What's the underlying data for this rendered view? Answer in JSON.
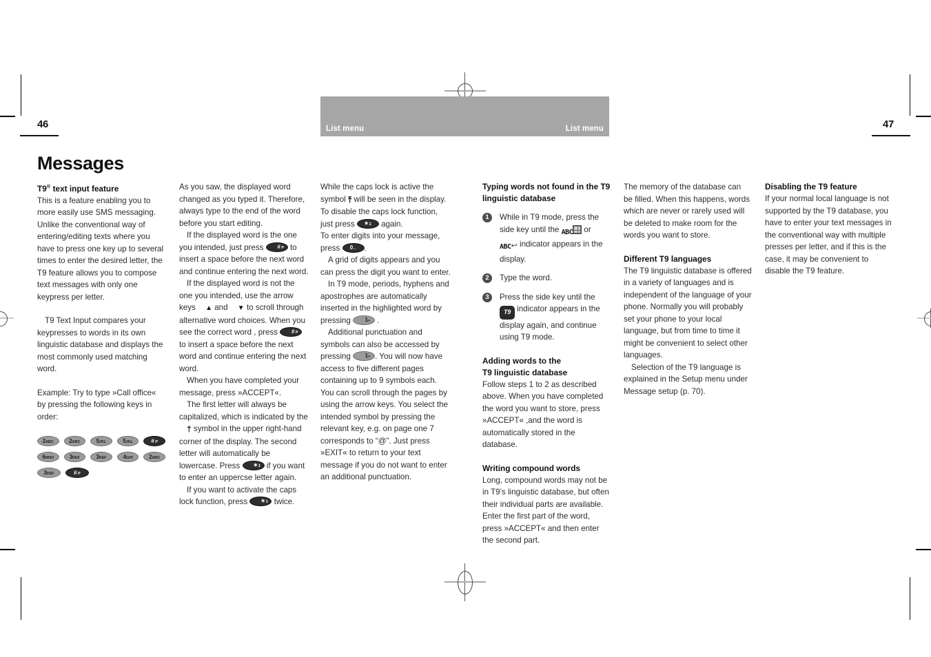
{
  "meta": {
    "left_page_number": "46",
    "right_page_number": "47",
    "band_color": "#a6a6a6"
  },
  "running_head": {
    "left_label": "List menu",
    "right_label": "List menu"
  },
  "chapter": {
    "title": "Messages"
  },
  "columns": {
    "c1": {
      "heading": "T9",
      "heading_sup": "®",
      "heading_rest": " text input feature",
      "p1": "This is a feature enabling you to more easily use SMS messaging. Unlike the conventional way of entering/editing texts where you have to press one key up to several times to enter the desired letter, the T9 feature allows you to compose text messages with only one keypress per letter.",
      "p2": "T9 Text Input compares your keypresses to words in its own linguistic database and displays the most commonly used matching word.",
      "p3": "Example: Try to type »Call office« by pressing the following keys in order:",
      "keys": [
        [
          {
            "digit": "2",
            "letters": "ABC",
            "style": "light"
          },
          {
            "digit": "2",
            "letters": "ABC",
            "style": "light"
          },
          {
            "digit": "5",
            "letters": "JKL",
            "style": "light"
          },
          {
            "digit": "5",
            "letters": "JKL",
            "style": "light"
          },
          {
            "digit": "#",
            "letters": "P",
            "style": "dark"
          }
        ],
        [
          {
            "digit": "6",
            "letters": "MNO",
            "style": "light"
          },
          {
            "digit": "3",
            "letters": "DEF",
            "style": "light"
          },
          {
            "digit": "3",
            "letters": "DEF",
            "style": "light"
          },
          {
            "digit": "4",
            "letters": "GHI",
            "style": "light"
          },
          {
            "digit": "2",
            "letters": "ABC",
            "style": "light"
          }
        ],
        [
          {
            "digit": "3",
            "letters": "DEF",
            "style": "light"
          },
          {
            "digit": "#",
            "letters": "P",
            "style": "dark"
          }
        ]
      ]
    },
    "c2": {
      "p1": "As you saw, the displayed word changed as you typed it. Therefore, always type to the end of the word before you start editing.",
      "p2a": "If the displayed word is the one you intended, just press",
      "p2b": "to insert a space before the next word and continue entering the next word.",
      "p3a": "If the displayed word is not the one you intended, use the arrow keys",
      "p3b": "and",
      "p3c": "to scroll through alternative word choices. When you see the correct word , press",
      "p3d": "to insert a space before the next word and continue entering the next word.",
      "p4": "When you have completed your message, press »ACCEPT«.",
      "p5a": "The first letter will always be capitalized, which is indicated by the",
      "p5b": "symbol in the upper right-hand corner of the display. The second letter will automatically be lowercase. Press",
      "p5c": "if you want to enter an uppercse letter again.",
      "p6a": "If you want to activate the caps lock function, press",
      "p6b": "twice.",
      "key_hash": {
        "digit": "#",
        "letters": "P",
        "style": "dark"
      },
      "key_star": {
        "digit": "✶",
        "letters": "↧",
        "style": "dark"
      },
      "arrow_up": "▲",
      "arrow_down": "▼",
      "caps_symbol": "†"
    },
    "c3": {
      "p1a": "While the caps lock is active the symbol",
      "p1b": "will be seen in the display. To disable the caps lock function, just press",
      "p1c": "again.",
      "p2a": "To enter digits into your message, press",
      "p2b": ".",
      "p3": "A grid of digits appears and you can press the digit you want to enter.",
      "p4a": "In T9 mode, periods, hyphens and apostrophes are automatically inserted in the highlighted word by pressing",
      "p4b": ".",
      "p5a": "Additional punctuation and symbols can also be accessed by pressing",
      "p5b": ". You will now have access to five different pages containing up to 9 symbols each. You can scroll through the pages by using the arrow keys. You select the intended symbol by pressing the relevant key, e.g. on page one 7 corresponds to “@”. Just press »EXIT« to return to your text message if you do not want to enter an additional punctuation.",
      "capslock_symbol": "⤒",
      "key_star": {
        "digit": "✶",
        "letters": "↧",
        "style": "dark"
      },
      "key_zero": {
        "digit": "0",
        "letters": "↔",
        "style": "dark"
      },
      "key_one": {
        "digit": "1",
        "letters": "∞",
        "style": "light"
      }
    },
    "c4": {
      "heading1_line1": "Typing words not found in the T9",
      "heading1_line2": "linguistic database",
      "steps": [
        {
          "num": "1",
          "text_a": "While in T9 mode, press the side key until the",
          "indicator_a": "ABC",
          "text_b": "or",
          "indicator_b": "ABC",
          "text_c": "indicator appears in the display."
        },
        {
          "num": "2",
          "text_a": "Type the word."
        },
        {
          "num": "3",
          "text_a": "Press the side key until the",
          "indicator_t9": "T9",
          "text_b": "indicator appears in the display again, and continue using T9 mode."
        }
      ],
      "heading2_line1": "Adding words to the",
      "heading2_line2": "T9 linguistic database",
      "p1": "Follow steps 1 to 2 as described above. When you have completed the word you want to store, press »ACCEPT« ,and the word is automatically stored in the database.",
      "heading3": "Writing compound words",
      "p2": "Long, compound words may not be in T9’s linguistic database, but often their individual parts are available. Enter the first part of the word, press »ACCEPT« and then enter the second part."
    },
    "c5": {
      "p1": "The memory of the database can be filled. When this happens, words which are never or rarely used will be deleted to make room for the words you want to store.",
      "heading1": "Different T9 languages",
      "p2": "The T9 linguistic database is offered in a variety of languages and is independent of the language of your phone. Normally you will probably set your phone to your local language, but from time to time it might be convenient to select other languages.",
      "p3": "Selection of the T9 language is explained in the Setup menu under Message setup (p. 70)."
    },
    "c6": {
      "heading1": "Disabling the T9 feature",
      "p1": "If your normal local language is not supported by the T9 database, you have to enter your text messages in the conventional way with multiple presses per letter, and if this is the case, it may be convenient to disable the T9 feature."
    }
  }
}
